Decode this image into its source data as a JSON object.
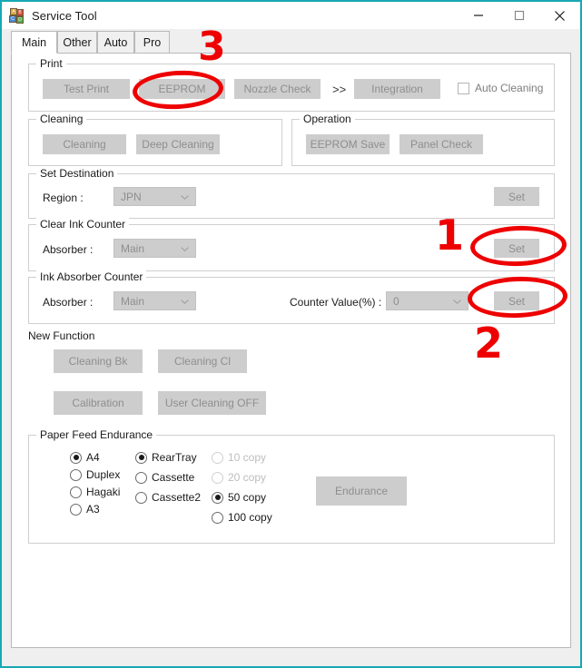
{
  "window": {
    "title": "Service Tool",
    "icon": "blocks-icon",
    "accent_border_color": "#17a8b4",
    "controls": [
      {
        "name": "minimize",
        "glyph": "minimize-icon"
      },
      {
        "name": "maximize",
        "glyph": "maximize-icon"
      },
      {
        "name": "close",
        "glyph": "close-icon"
      }
    ]
  },
  "tabs": [
    {
      "label": "Main",
      "selected": true
    },
    {
      "label": "Other",
      "selected": false
    },
    {
      "label": "Auto",
      "selected": false
    },
    {
      "label": "Pro",
      "selected": false
    }
  ],
  "print": {
    "legend": "Print",
    "test_print": "Test Print",
    "eeprom": "EEPROM",
    "nozzle_check": "Nozzle Check",
    "arrows": ">>",
    "integration": "Integration",
    "auto_cleaning": "Auto Cleaning",
    "auto_cleaning_checked": false
  },
  "cleaning": {
    "legend": "Cleaning",
    "cleaning": "Cleaning",
    "deep_cleaning": "Deep Cleaning"
  },
  "operation": {
    "legend": "Operation",
    "eeprom_save": "EEPROM Save",
    "panel_check": "Panel Check"
  },
  "set_destination": {
    "legend": "Set Destination",
    "region_label": "Region :",
    "region_value": "JPN",
    "set": "Set"
  },
  "clear_ink_counter": {
    "legend": "Clear Ink Counter",
    "absorber_label": "Absorber :",
    "absorber_value": "Main",
    "set": "Set"
  },
  "ink_absorber_counter": {
    "legend": "Ink Absorber Counter",
    "absorber_label": "Absorber :",
    "absorber_value": "Main",
    "counter_label": "Counter Value(%) :",
    "counter_value": "0",
    "set": "Set"
  },
  "new_function": {
    "legend": "New Function",
    "cleaning_bk": "Cleaning Bk",
    "cleaning_cl": "Cleaning Cl",
    "calibration": "Calibration",
    "user_cleaning_off": "User Cleaning OFF"
  },
  "paper_feed_endurance": {
    "legend": "Paper Feed Endurance",
    "endurance_button": "Endurance",
    "paper_sizes": [
      {
        "label": "A4",
        "selected": true,
        "disabled": false
      },
      {
        "label": "Duplex",
        "selected": false,
        "disabled": false
      },
      {
        "label": "Hagaki",
        "selected": false,
        "disabled": false
      },
      {
        "label": "A3",
        "selected": false,
        "disabled": false
      }
    ],
    "sources": [
      {
        "label": "RearTray",
        "selected": true,
        "disabled": false
      },
      {
        "label": "Cassette",
        "selected": false,
        "disabled": false
      },
      {
        "label": "Cassette2",
        "selected": false,
        "disabled": false
      }
    ],
    "copies": [
      {
        "label": "10 copy",
        "selected": false,
        "disabled": true
      },
      {
        "label": "20 copy",
        "selected": false,
        "disabled": true
      },
      {
        "label": "50 copy",
        "selected": true,
        "disabled": false
      },
      {
        "label": "100 copy",
        "selected": false,
        "disabled": false
      }
    ]
  },
  "annotations": {
    "color": "#ee0000",
    "markers": [
      {
        "label": "1",
        "target": "clear-ink-counter-set-button"
      },
      {
        "label": "2",
        "target": "ink-absorber-counter-set-button"
      },
      {
        "label": "3",
        "target": "eeprom-button"
      }
    ]
  }
}
